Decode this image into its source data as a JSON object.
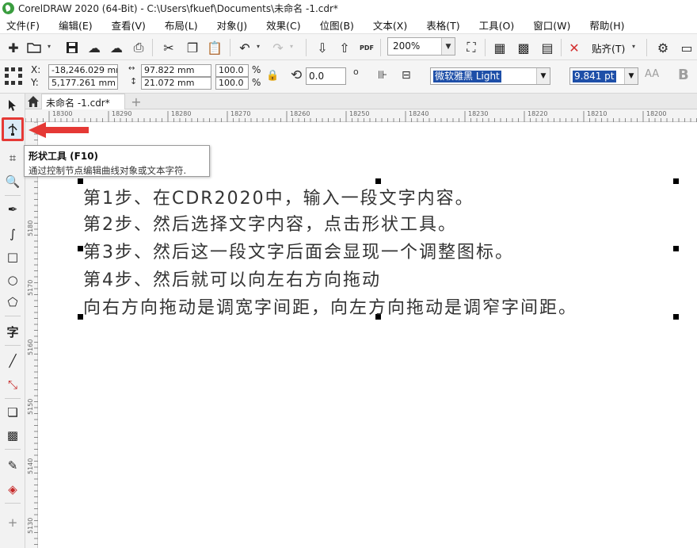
{
  "window": {
    "title": "CorelDRAW 2020 (64-Bit) - C:\\Users\\fkuef\\Documents\\未命名 -1.cdr*"
  },
  "menu": [
    "文件(F)",
    "编辑(E)",
    "查看(V)",
    "布局(L)",
    "对象(J)",
    "效果(C)",
    "位图(B)",
    "文本(X)",
    "表格(T)",
    "工具(O)",
    "窗口(W)",
    "帮助(H)"
  ],
  "toolbar": {
    "zoom": "200%",
    "snap_label": "贴齐(T)",
    "pdf_label": "PDF"
  },
  "property_bar": {
    "x_label": "X:",
    "y_label": "Y:",
    "x_value": "-18,246.029 mm",
    "y_value": "5,177.261 mm",
    "width_value": "97.822 mm",
    "height_value": "21.072 mm",
    "scale_w": "100.0",
    "scale_h": "100.0",
    "percent": "%",
    "rotation": "0.0",
    "font_name": "微软雅黑 Light",
    "font_size": "9.841 pt"
  },
  "document_tab": {
    "label": "未命名 -1.cdr*"
  },
  "ruler": {
    "top_labels": [
      "18300",
      "18290",
      "18280",
      "18270",
      "18260",
      "18250",
      "18240",
      "18230",
      "18220",
      "18210",
      "18200"
    ],
    "left_labels": [
      "5180",
      "5170",
      "5160",
      "5150",
      "5140",
      "5130"
    ]
  },
  "tooltip": {
    "title": "形状工具 (F10)",
    "body": "通过控制节点编辑曲线对象或文本字符."
  },
  "canvas_text": [
    "第1步、在CDR2020中，输入一段文字内容。",
    "第2步、然后选择文字内容，点击形状工具。",
    "第3步、然后这一段文字后面会显现一个调整图标。",
    "第4步、然后就可以向左右方向拖动",
    "向右方向拖动是调宽字间距，向左方向拖动是调窄字间距。"
  ],
  "colors": {
    "accent_selection": "#1e4fa8",
    "highlight_red": "#e53935",
    "logo_green": "#3a9d3f"
  }
}
